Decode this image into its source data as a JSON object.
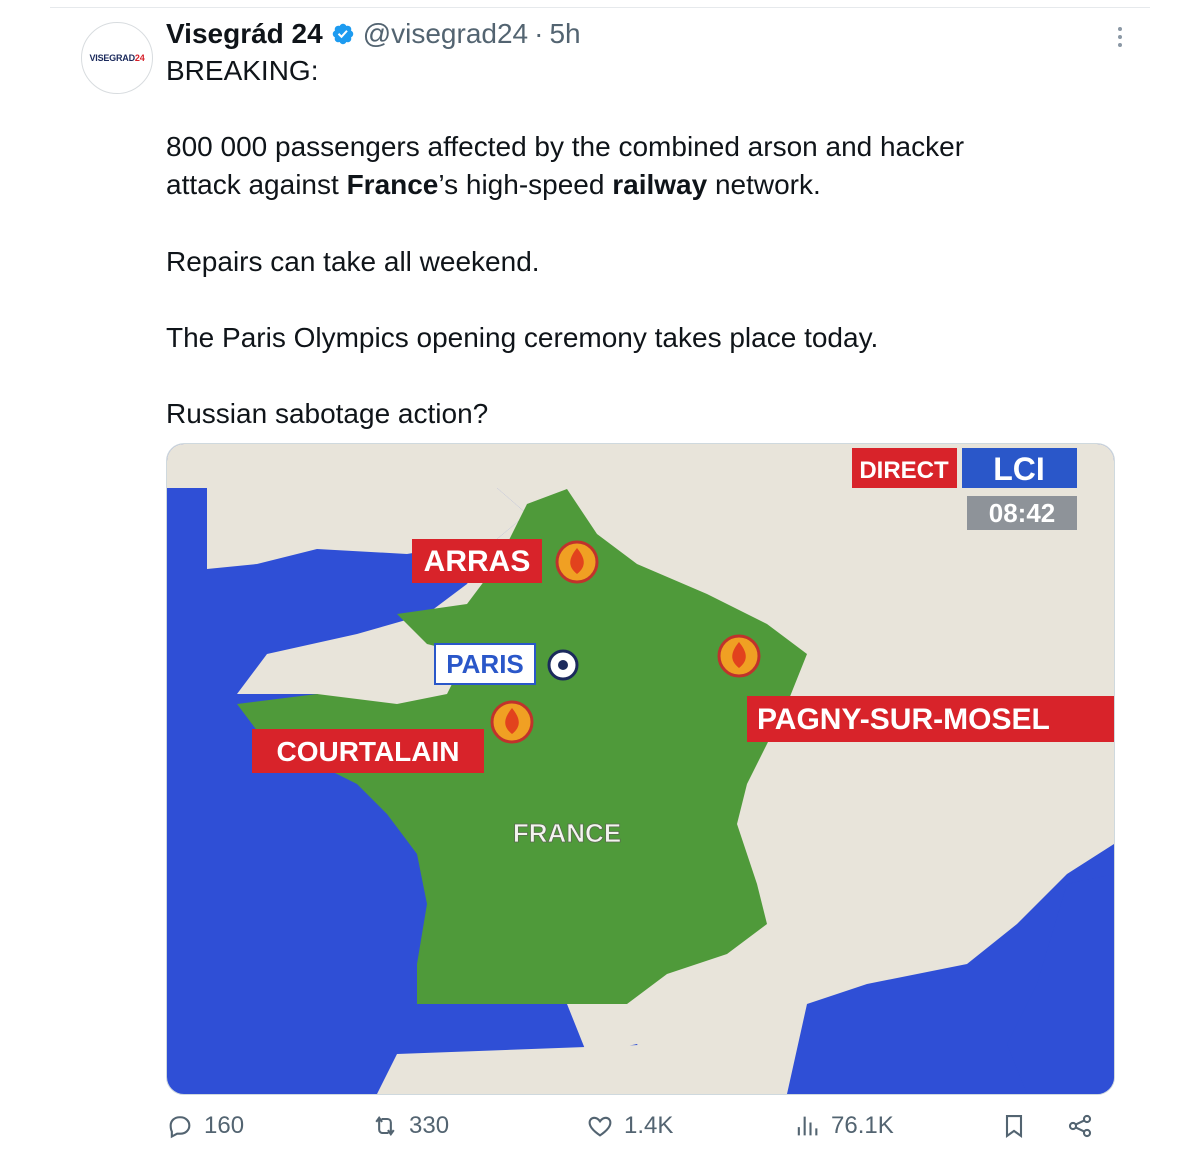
{
  "author": {
    "avatar_text_1": "VISEGRAD",
    "avatar_text_2": "24",
    "name": "Visegrád 24",
    "handle": "@visegrad24",
    "separator": "·",
    "time": "5h",
    "verified_icon": "verified-badge-icon"
  },
  "tweet": {
    "line1": "BREAKING:",
    "para1_a": "800 000 passengers affected by the combined arson and hacker",
    "para1_b_pre": "attack against ",
    "para1_b_bold1": "France",
    "para1_b_mid": "’s high-speed ",
    "para1_b_bold2": "railway",
    "para1_b_post": " network.",
    "para2": "Repairs can take all weekend.",
    "para3": "The Paris Olympics opening ceremony takes place today.",
    "para4": "Russian sabotage action?"
  },
  "media": {
    "direct": "DIRECT",
    "channel": "LCI",
    "clock": "08:42",
    "labels": {
      "arras": "ARRAS",
      "paris": "PARIS",
      "courtalain": "COURTALAIN",
      "pagny": "PAGNY-SUR-MOSEL",
      "france": "FRANCE"
    },
    "colors": {
      "sea": "#2f4fd6",
      "land_france": "#4f9a3a",
      "land_other": "#e8e4da",
      "label_red": "#d8232a",
      "fire_orange": "#f0a023"
    }
  },
  "actions": {
    "reply_count": "160",
    "repost_count": "330",
    "like_count": "1.4K",
    "view_count": "76.1K",
    "icons": [
      "reply-icon",
      "repost-icon",
      "like-icon",
      "views-icon",
      "bookmark-icon",
      "share-icon"
    ]
  }
}
